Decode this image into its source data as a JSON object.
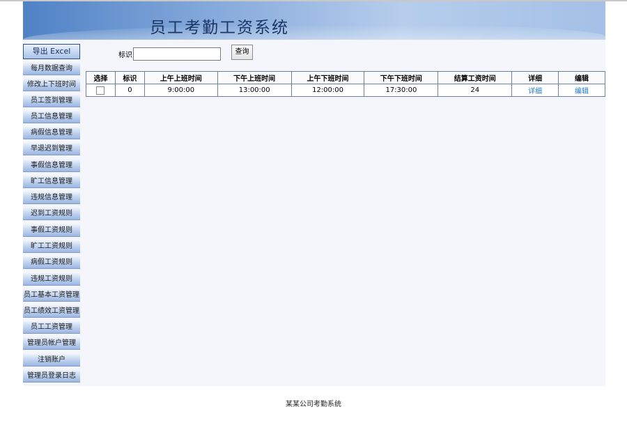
{
  "app": {
    "title": "员工考勤工资系统"
  },
  "search": {
    "label": "标识",
    "value": "",
    "placeholder": "",
    "button": "查询"
  },
  "sidebar": {
    "export": "导出 Excel",
    "items": [
      "每月数据查询",
      "修改上下班时间",
      "员工签到管理",
      "员工信息管理",
      "病假信息管理",
      "早退迟到管理",
      "事假信息管理",
      "旷工信息管理",
      "违规信息管理",
      "迟到工资规则",
      "事假工资规则",
      "旷工工资规则",
      "病假工资规则",
      "违规工资规则",
      "员工基本工资管理",
      "员工绩效工资管理",
      "员工工资管理",
      "管理员帐户管理",
      "注销账户",
      "管理员登录日志"
    ]
  },
  "table": {
    "headers": [
      "选择",
      "标识",
      "上午上班时间",
      "下午上班时间",
      "上午下班时间",
      "下午下班时间",
      "结算工资时间",
      "详细",
      "编辑"
    ],
    "rows": [
      {
        "id": "0",
        "am_in": "9:00:00",
        "pm_in": "13:00:00",
        "am_out": "12:00:00",
        "pm_out": "17:30:00",
        "settle": "24",
        "detail": "详细",
        "edit": "编辑"
      }
    ]
  },
  "footer": {
    "text": "某某公司考勤系统"
  },
  "colors": {
    "accent": "#4f82c6",
    "link": "#1e78c8",
    "sidebar": "#bcd0ee"
  }
}
